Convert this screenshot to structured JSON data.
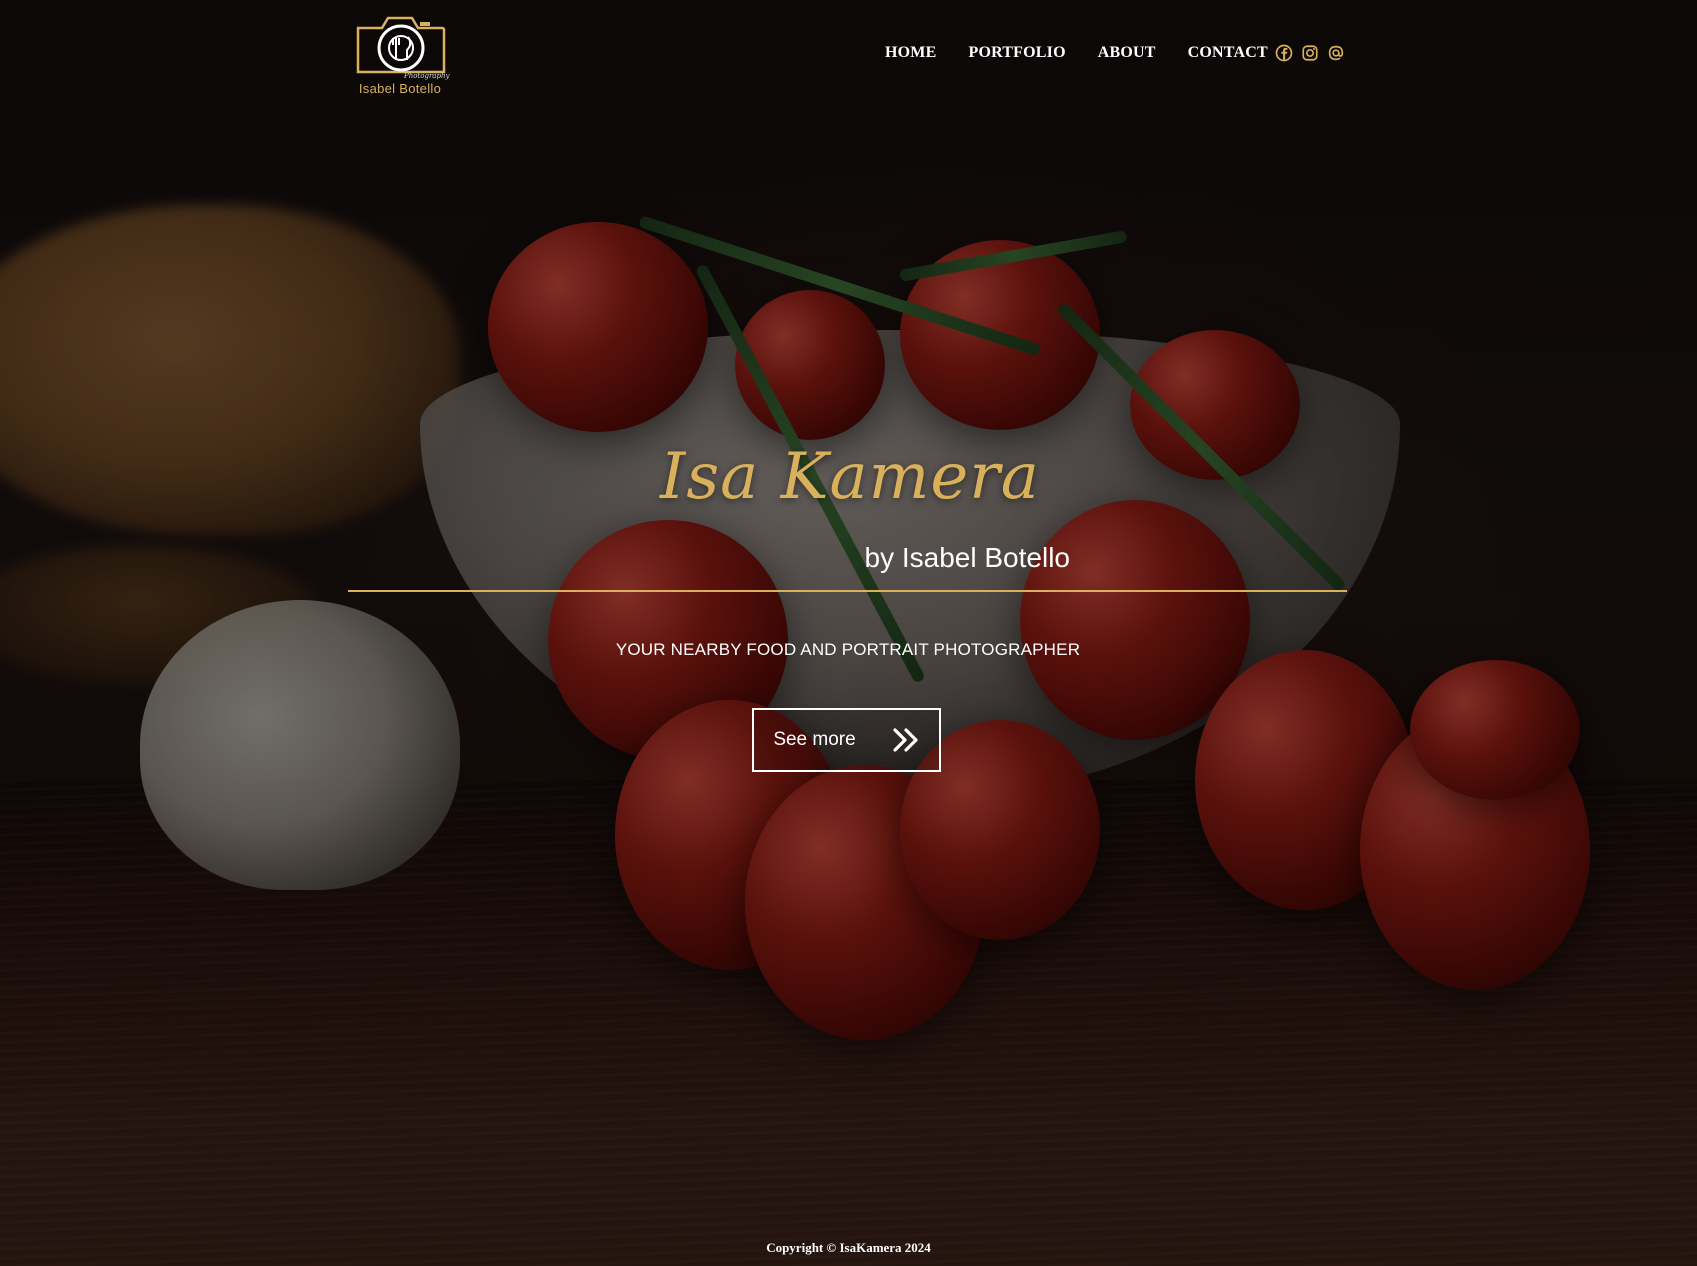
{
  "brand": {
    "logo_name": "Isabel Botello",
    "logo_script": "Photography",
    "accent_color": "#d9b15c"
  },
  "nav": {
    "items": [
      {
        "label": "HOME"
      },
      {
        "label": "PORTFOLIO"
      },
      {
        "label": "ABOUT"
      },
      {
        "label": "CONTACT"
      }
    ]
  },
  "social": {
    "icons": [
      "facebook-icon",
      "instagram-icon",
      "email-at-icon"
    ]
  },
  "hero": {
    "title": "Isa Kamera",
    "subtitle": "by Isabel Botello",
    "tagline": "YOUR NEARBY FOOD AND PORTRAIT PHOTOGRAPHER",
    "button_label": "See more",
    "button_icon": "double-chevron-right-icon"
  },
  "footer": {
    "copyright": "Copyright © IsaKamera 2024"
  }
}
